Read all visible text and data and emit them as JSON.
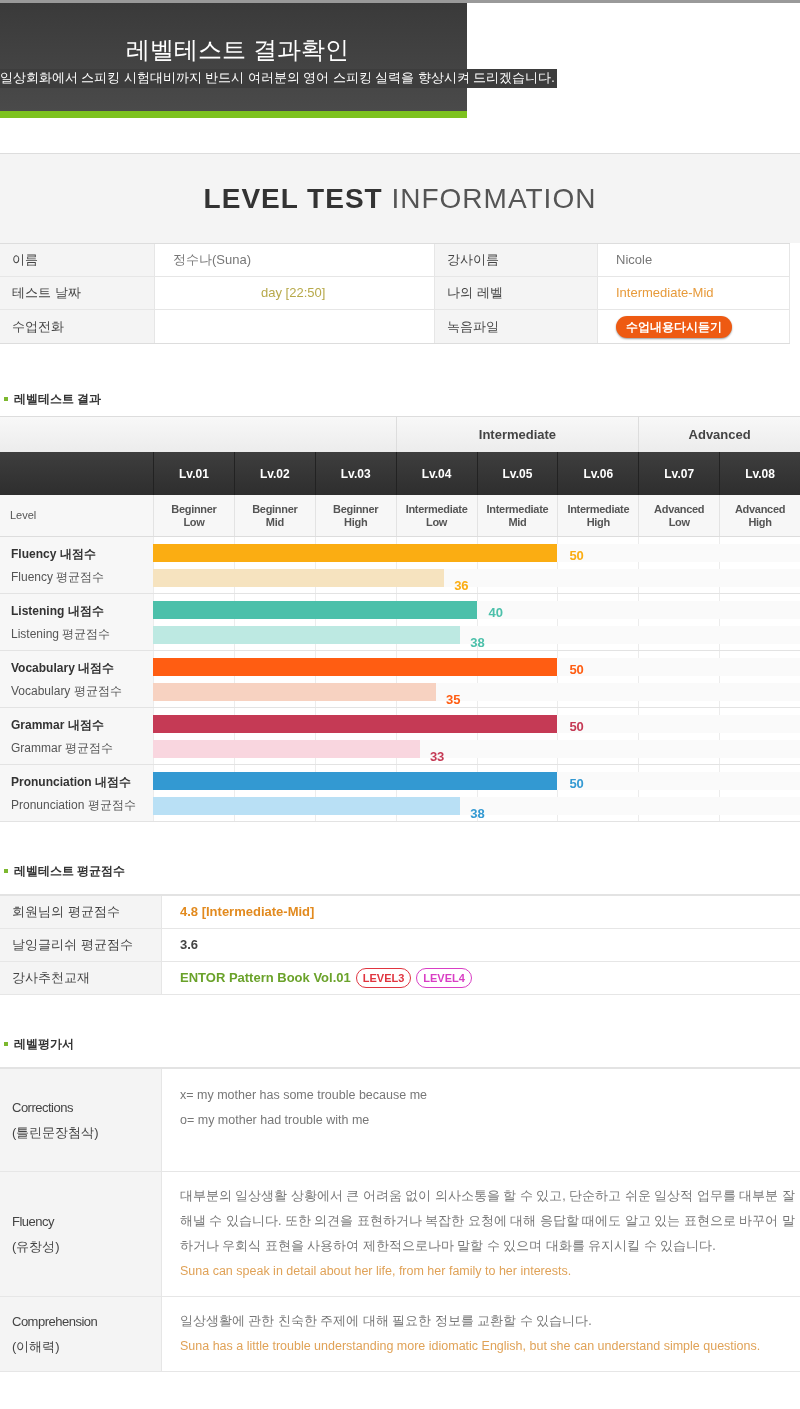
{
  "header": {
    "title": "레벨테스트 결과확인",
    "subtitle": "일상회화에서 스피킹 시험대비까지 반드시 여러분의 영어 스피킹 실력을 향상시켜 드리겠습니다."
  },
  "info": {
    "title_bold": "LEVEL TEST",
    "title_light": "INFORMATION",
    "rows": [
      [
        {
          "label": "이름",
          "value": "정수나(Suna)",
          "kind": "text"
        },
        {
          "label": "강사이름",
          "value": "Nicole",
          "kind": "text"
        }
      ],
      [
        {
          "label": "테스트 날짜",
          "value": "day [22:50]",
          "kind": "date"
        },
        {
          "label": "나의 레벨",
          "value": "Intermediate-Mid",
          "kind": "level"
        }
      ],
      [
        {
          "label": "수업전화",
          "kind": "empty"
        },
        {
          "label": "녹음파일",
          "value": "수업내용다시듣기",
          "kind": "button"
        }
      ]
    ]
  },
  "result": {
    "heading": "레벨테스트 결과",
    "groups": [
      {
        "label": "Intermediate"
      },
      {
        "label": "Advanced"
      }
    ],
    "level_label": "Level",
    "levels": [
      {
        "code": "Lv.01",
        "name": [
          "Beginner",
          "Low"
        ]
      },
      {
        "code": "Lv.02",
        "name": [
          "Beginner",
          "Mid"
        ]
      },
      {
        "code": "Lv.03",
        "name": [
          "Beginner",
          "High"
        ]
      },
      {
        "code": "Lv.04",
        "name": [
          "Intermediate",
          "Low"
        ]
      },
      {
        "code": "Lv.05",
        "name": [
          "Intermediate",
          "Mid"
        ]
      },
      {
        "code": "Lv.06",
        "name": [
          "Intermediate",
          "High"
        ]
      },
      {
        "code": "Lv.07",
        "name": [
          "Advanced",
          "Low"
        ]
      },
      {
        "code": "Lv.08",
        "name": [
          "Advanced",
          "High"
        ]
      }
    ],
    "skills": [
      {
        "bars": [
          {
            "kind": "mine",
            "label": "Fluency 내점수",
            "value": "50",
            "level": 0.625,
            "color": "#fbad12"
          },
          {
            "kind": "average",
            "label": "Fluency 평균점수",
            "value": "36",
            "level": 0.45,
            "color": "#f6e3bf"
          }
        ]
      },
      {
        "bars": [
          {
            "kind": "mine",
            "label": "Listening 내점수",
            "value": "40",
            "level": 0.5,
            "color": "#4cc0aa"
          },
          {
            "kind": "average",
            "label": "Listening 평균점수",
            "value": "38",
            "level": 0.475,
            "color": "#bde9e2"
          }
        ]
      },
      {
        "bars": [
          {
            "kind": "mine",
            "label": "Vocabulary 내점수",
            "value": "50",
            "level": 0.625,
            "color": "#ff5d12"
          },
          {
            "kind": "average",
            "label": "Vocabulary 평균점수",
            "value": "35",
            "level": 0.4375,
            "color": "#f7d2c1"
          }
        ]
      },
      {
        "bars": [
          {
            "kind": "mine",
            "label": "Grammar 내점수",
            "value": "50",
            "level": 0.625,
            "color": "#c53a55"
          },
          {
            "kind": "average",
            "label": "Grammar 평균점수",
            "value": "33",
            "level": 0.4125,
            "color": "#f9d6df"
          }
        ]
      },
      {
        "bars": [
          {
            "kind": "mine",
            "label": "Pronunciation 내점수",
            "value": "50",
            "level": 0.625,
            "color": "#3399d2"
          },
          {
            "kind": "average",
            "label": "Pronunciation 평균점수",
            "value": "38",
            "level": 0.475,
            "color": "#b9e0f5"
          }
        ]
      }
    ]
  },
  "average": {
    "heading": "레벨테스트 평균점수",
    "rows": [
      {
        "label": "회원님의 평균점수",
        "value": "4.8 [Intermediate-Mid]",
        "kind": "level"
      },
      {
        "label": "날잉글리쉬 평균점수",
        "value": "3.6",
        "kind": "plain"
      },
      {
        "label": "강사추천교재",
        "value": "ENTOR Pattern Book Vol.01",
        "kind": "book",
        "tags": [
          {
            "label": "LEVEL3",
            "color": "#e0343f"
          },
          {
            "label": "LEVEL4",
            "color": "#d93ec4"
          }
        ]
      }
    ]
  },
  "evaluation": {
    "heading": "레벨평가서",
    "rows": [
      {
        "label": "Corrections",
        "sub": "(틀린문장첨삭)",
        "lines": [
          {
            "kind": "plain",
            "text": "x= my mother has some trouble because me"
          },
          {
            "kind": "plain",
            "text": "o= my mother had trouble with me"
          }
        ]
      },
      {
        "label": "Fluency",
        "sub": "(유창성)",
        "lines": [
          {
            "kind": "plain",
            "text": "대부분의 일상생활 상황에서 큰 어려움 없이 의사소통을 할 수 있고, 단순하고 쉬운 일상적 업무를 대부분 잘 해낼 수 있습니다. 또한 의견을 표현하거나 복잡한 요청에 대해 응답할 때에도 알고 있는 표현으로 바꾸어 말하거나 우회식 표현을 사용하여 제한적으로나마 말할 수 있으며 대화를 유지시킬 수 있습니다."
          },
          {
            "kind": "highlight",
            "text": "Suna can speak in detail about her life, from her family to her interests."
          }
        ]
      },
      {
        "label": "Comprehension",
        "sub": "(이해력)",
        "lines": [
          {
            "kind": "plain",
            "text": "일상생활에 관한 친숙한 주제에 대해 필요한 정보를 교환할 수 있습니다."
          },
          {
            "kind": "highlight",
            "text": "Suna has a little trouble understanding more idiomatic English, but she can understand simple questions."
          }
        ]
      }
    ]
  }
}
